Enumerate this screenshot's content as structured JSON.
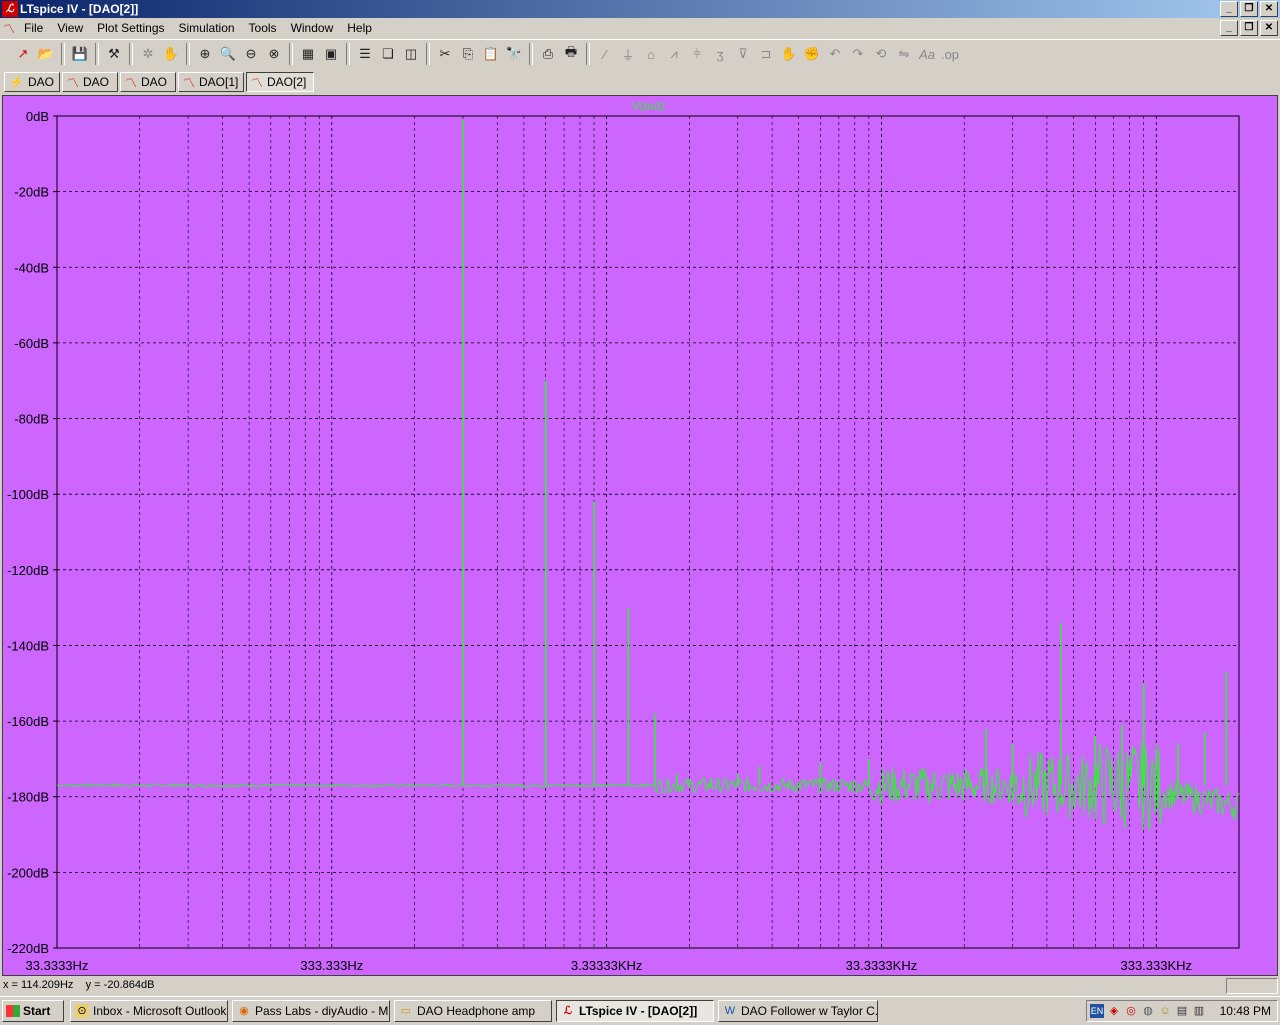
{
  "window": {
    "title": "LTspice IV - [DAO[2]]"
  },
  "menu": {
    "items": [
      "File",
      "View",
      "Plot Settings",
      "Simulation",
      "Tools",
      "Window",
      "Help"
    ]
  },
  "toolbar": {
    "icons": [
      "new-schematic-icon",
      "open-icon",
      "save-icon",
      "control-panel-icon",
      "run-icon",
      "pan-icon",
      "zoom-in-icon",
      "zoom-area-icon",
      "zoom-out-icon",
      "zoom-cancel-icon",
      "autorange-icon",
      "fit-icon",
      "tile-horizontal-icon",
      "cascade-icon",
      "tile-vertical-icon",
      "cut-icon",
      "copy-icon",
      "paste-icon",
      "find-icon",
      "print-setup-icon",
      "print-icon",
      "wire-icon",
      "ground-icon",
      "label-icon",
      "resistor-icon",
      "capacitor-icon",
      "inductor-icon",
      "diode-icon",
      "component-icon",
      "move-icon",
      "drag-icon",
      "undo-icon",
      "redo-icon",
      "rotate-icon",
      "mirror-icon",
      "text-icon",
      "spice-directive-icon"
    ]
  },
  "tabs": [
    {
      "label": "DAO",
      "kind": "schematic"
    },
    {
      "label": "DAO",
      "kind": "waveform"
    },
    {
      "label": "DAO",
      "kind": "waveform"
    },
    {
      "label": "DAO[1]",
      "kind": "waveform"
    },
    {
      "label": "DAO[2]",
      "kind": "waveform",
      "active": true
    }
  ],
  "plot": {
    "background": "#cc66ff",
    "trace_color": "#33ee33",
    "grid_color": "#000000"
  },
  "chart_data": {
    "type": "line",
    "title": "V(out)",
    "xscale": "log",
    "xlim": [
      33.3333,
      666666
    ],
    "ylim": [
      -220,
      0
    ],
    "ylabel": "",
    "xlabel": "",
    "x_ticks": [
      "33.3333Hz",
      "333.333Hz",
      "3.33333KHz",
      "33.3333KHz",
      "333.333KHz"
    ],
    "y_ticks": [
      "0dB",
      "-20dB",
      "-40dB",
      "-60dB",
      "-80dB",
      "-100dB",
      "-120dB",
      "-140dB",
      "-160dB",
      "-180dB",
      "-200dB",
      "-220dB"
    ],
    "grid": true,
    "noise_floor_db": -177,
    "spikes": [
      {
        "x": 1000,
        "y": -1
      },
      {
        "x": 2000,
        "y": -70
      },
      {
        "x": 3000,
        "y": -102
      },
      {
        "x": 4000,
        "y": -130
      },
      {
        "x": 5000,
        "y": -158
      },
      {
        "x": 6000,
        "y": -174
      },
      {
        "x": 8000,
        "y": -175
      },
      {
        "x": 10000,
        "y": -174
      },
      {
        "x": 12000,
        "y": -172
      },
      {
        "x": 20000,
        "y": -171
      },
      {
        "x": 30000,
        "y": -170
      },
      {
        "x": 80000,
        "y": -162
      },
      {
        "x": 100000,
        "y": -166
      },
      {
        "x": 150000,
        "y": -134
      },
      {
        "x": 200000,
        "y": -164
      },
      {
        "x": 250000,
        "y": -161
      },
      {
        "x": 300000,
        "y": -150
      },
      {
        "x": 400000,
        "y": -166
      },
      {
        "x": 500000,
        "y": -163
      },
      {
        "x": 600000,
        "y": -147
      }
    ]
  },
  "status": {
    "readout": "x = 114.209Hz    y = -20.864dB"
  },
  "taskbar": {
    "start": "Start",
    "tasks": [
      {
        "label": "Inbox - Microsoft Outlook",
        "icon": "outlook-icon"
      },
      {
        "label": "Pass Labs - diyAudio - M...",
        "icon": "firefox-icon"
      },
      {
        "label": "DAO Headphone amp",
        "icon": "folder-icon"
      },
      {
        "label": "LTspice IV - [DAO[2]]",
        "icon": "ltspice-icon",
        "active": true
      },
      {
        "label": "DAO Follower w Taylor C...",
        "icon": "word-icon"
      }
    ],
    "tray_lang": "EN",
    "clock": "10:48 PM"
  }
}
